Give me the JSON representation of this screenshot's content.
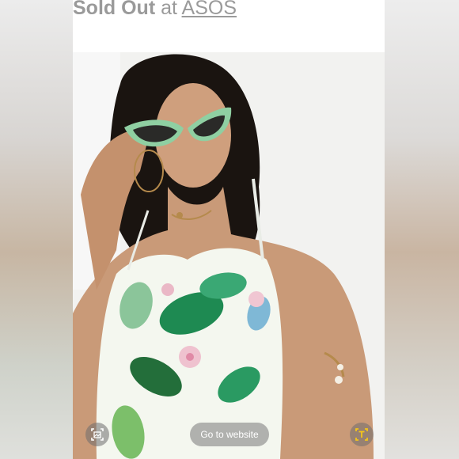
{
  "header": {
    "status_text": "Sold Out",
    "connector_text": "at",
    "store_link": "ASOS"
  },
  "actions": {
    "go_to_website_label": "Go to website",
    "left_icon": "image-scan-icon",
    "right_icon": "text-recognition-icon"
  },
  "colors": {
    "header_text": "#9a9a9a",
    "text_icon_accent": "#f5c518"
  }
}
